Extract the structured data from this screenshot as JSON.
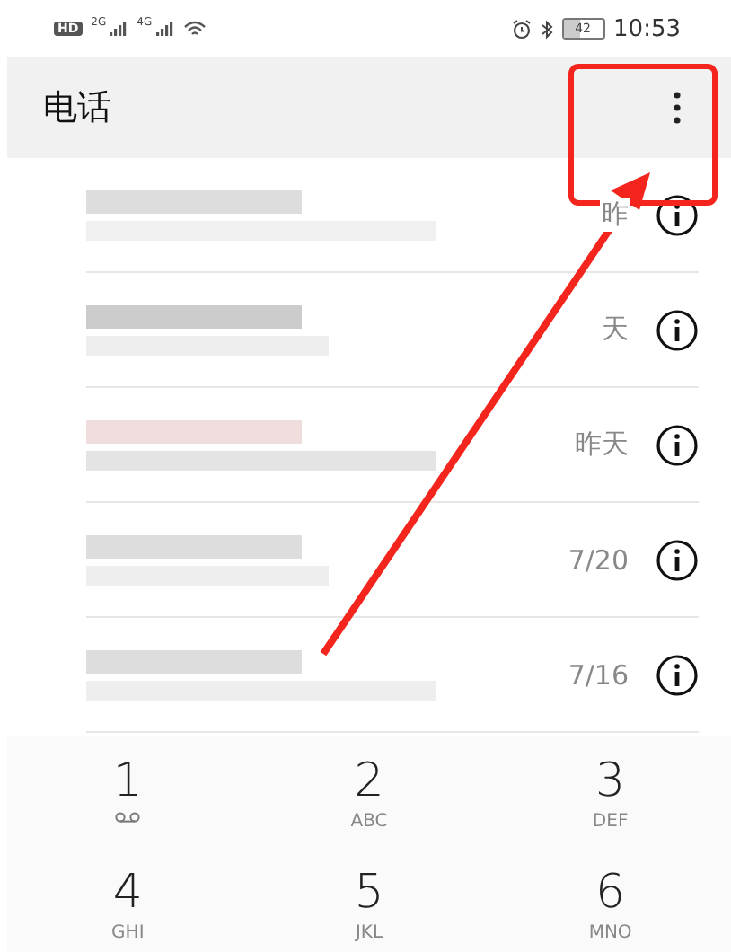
{
  "status_bar": {
    "hd": "HD",
    "networks": [
      "2G",
      "4G"
    ],
    "battery": "42",
    "time": "10:53"
  },
  "header": {
    "title": "电话"
  },
  "calls": [
    {
      "time": "昨"
    },
    {
      "time": "天"
    },
    {
      "time": "昨天"
    },
    {
      "time": "7/20"
    },
    {
      "time": "7/16"
    }
  ],
  "keypad": [
    {
      "digit": "1",
      "kind": "voicemail"
    },
    {
      "digit": "2",
      "letters": "ABC",
      "kind": "letters"
    },
    {
      "digit": "3",
      "letters": "DEF",
      "kind": "letters"
    },
    {
      "digit": "4",
      "letters": "GHI",
      "kind": "letters"
    },
    {
      "digit": "5",
      "letters": "JKL",
      "kind": "letters"
    },
    {
      "digit": "6",
      "letters": "MNO",
      "kind": "letters"
    }
  ]
}
